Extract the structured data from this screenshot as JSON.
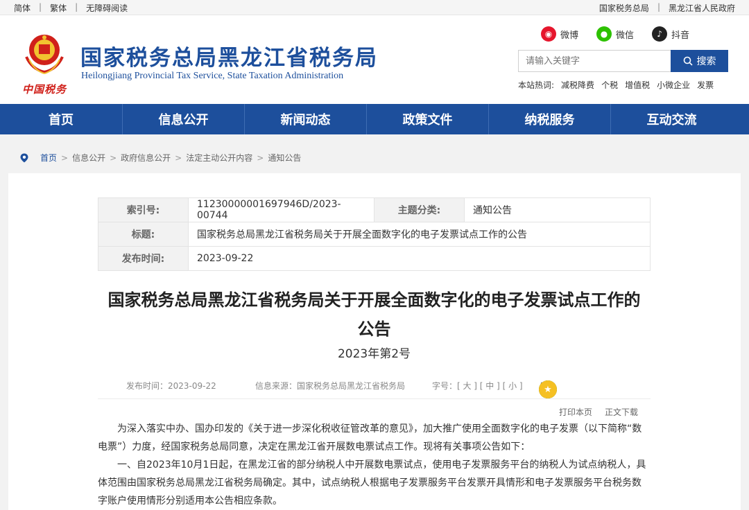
{
  "topbar": {
    "simplified": "简体",
    "traditional": "繁体",
    "accessible": "无障碍阅读",
    "link1": "国家税务总局",
    "link2": "黑龙江省人民政府"
  },
  "header": {
    "emblem_caption": "中国税务",
    "title": "国家税务总局黑龙江省税务局",
    "subtitle": "Heilongjiang Provincial Tax Service, State Taxation Administration",
    "social": {
      "weibo": "微博",
      "wechat": "微信",
      "douyin": "抖音"
    },
    "search": {
      "placeholder": "请输入关键字",
      "button": "搜索"
    },
    "hot": {
      "label": "本站热词:",
      "items": [
        "减税降费",
        "个税",
        "增值税",
        "小微企业",
        "发票"
      ]
    }
  },
  "nav": [
    "首页",
    "信息公开",
    "新闻动态",
    "政策文件",
    "纳税服务",
    "互动交流"
  ],
  "breadcrumb": [
    "首页",
    "信息公开",
    "政府信息公开",
    "法定主动公开内容",
    "通知公告"
  ],
  "meta": {
    "index_label": "索引号:",
    "index_value": "11230000001697946D/2023-00744",
    "topic_label": "主题分类:",
    "topic_value": "通知公告",
    "title_label": "标题:",
    "title_value": "国家税务总局黑龙江省税务局关于开展全面数字化的电子发票试点工作的公告",
    "date_label": "发布时间:",
    "date_value": "2023-09-22"
  },
  "article": {
    "title_line1": "国家税务总局黑龙江省税务局关于开展全面数字化的电子发票试点工作的",
    "title_line2": "公告",
    "number": "2023年第2号",
    "publish_time": "发布时间：2023-09-22",
    "source": "信息来源：国家税务总局黑龙江省税务局",
    "font_size": "字号：[ 大 ] [ 中 ] [ 小 ]",
    "print": "打印本页",
    "download": "正文下载",
    "para1": "为深入落实中办、国办印发的《关于进一步深化税收征管改革的意见》，加大推广使用全面数字化的电子发票（以下简称“数电票”）力度，经国家税务总局同意，决定在黑龙江省开展数电票试点工作。现将有关事项公告如下：",
    "para2": "一、自2023年10月1日起，在黑龙江省的部分纳税人中开展数电票试点，使用电子发票服务平台的纳税人为试点纳税人，具体范围由国家税务总局黑龙江省税务局确定。其中，试点纳税人根据电子发票服务平台发票开具情形和电子发票服务平台税务数字账户使用情形分别适用本公告相应条款。"
  },
  "colors": {
    "brand_blue": "#1d4f9c",
    "emblem_red": "#d0201a"
  }
}
